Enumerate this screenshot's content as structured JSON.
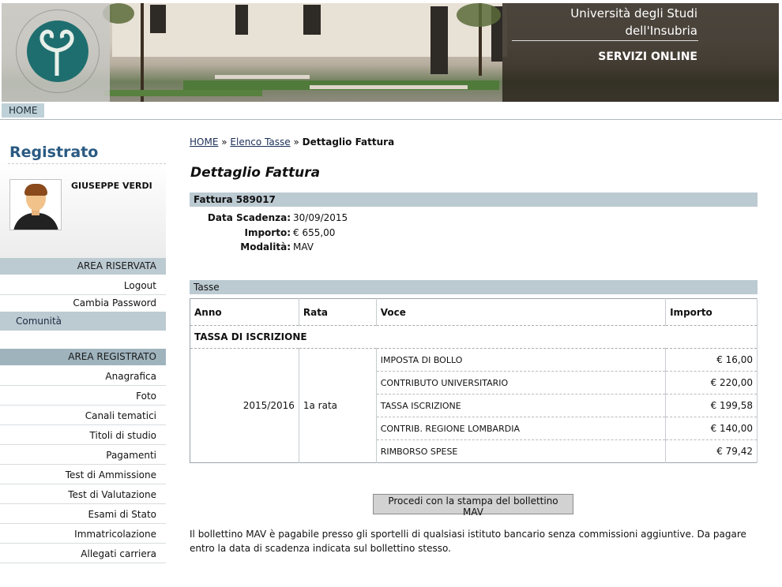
{
  "header": {
    "university_line1": "Università degli Studi",
    "university_line2": "dell'Insubria",
    "services": "SERVIZI ONLINE"
  },
  "topnav": {
    "home": "HOME"
  },
  "sidebar": {
    "title": "Registrato",
    "user_name": "GIUSEPPE VERDI",
    "area_riservata": {
      "heading": "AREA RISERVATA",
      "items": [
        "Logout",
        "Cambia Password"
      ]
    },
    "comunita": "Comunità",
    "area_registrato": {
      "heading": "AREA REGISTRATO",
      "items": [
        "Anagrafica",
        "Foto",
        "Canali tematici",
        "Titoli di studio",
        "Pagamenti",
        "Test di Ammissione",
        "Test di Valutazione",
        "Esami di Stato",
        "Immatricolazione",
        "Allegati carriera"
      ]
    }
  },
  "breadcrumb": {
    "home": "HOME",
    "sep1": "»",
    "elenco": "Elenco Tasse",
    "sep2": "»",
    "current": "Dettaglio Fattura"
  },
  "page_title": "Dettaglio Fattura",
  "fattura": {
    "heading": "Fattura 589017",
    "data_scadenza_label": "Data Scadenza:",
    "data_scadenza": "30/09/2015",
    "importo_label": "Importo:",
    "importo": "€ 655,00",
    "modalita_label": "Modalità:",
    "modalita": "MAV"
  },
  "tasse": {
    "heading": "Tasse",
    "columns": [
      "Anno",
      "Rata",
      "Voce",
      "Importo"
    ],
    "section": "TASSA DI ISCRIZIONE",
    "anno": "2015/2016",
    "rata": "1a rata",
    "rows": [
      {
        "voce": "IMPOSTA DI BOLLO",
        "importo": "€ 16,00"
      },
      {
        "voce": "CONTRIBUTO UNIVERSITARIO",
        "importo": "€ 220,00"
      },
      {
        "voce": "TASSA ISCRIZIONE",
        "importo": "€ 199,58"
      },
      {
        "voce": "CONTRIB. REGIONE LOMBARDIA",
        "importo": "€ 140,00"
      },
      {
        "voce": "RIMBORSO SPESE",
        "importo": "€ 79,42"
      }
    ]
  },
  "mav_button": "Procedi con la stampa del bollettino MAV",
  "note": "Il bollettino MAV è pagabile presso gli sportelli di qualsiasi istituto bancario senza commissioni aggiuntive. Da pagare entro la data di scadenza indicata sul bollettino stesso.",
  "colors": {
    "bar": "#bccad2",
    "title_blue": "#2a5a82",
    "teal_logo": "#1f6e6f"
  }
}
